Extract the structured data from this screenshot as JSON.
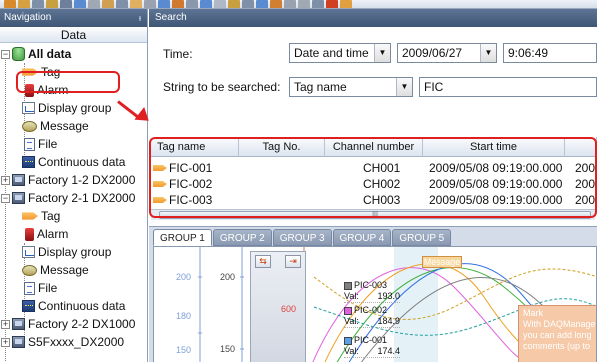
{
  "navigation": {
    "title": "Navigation",
    "pin_label": "ᵻ",
    "data_header": "Data",
    "tree": {
      "root_label": "All data",
      "root_children": [
        "Tag",
        "Alarm",
        "Display group",
        "Message",
        "File",
        "Continuous data"
      ],
      "groups": [
        {
          "label": "Factory 1-2 DX2000",
          "expander": "+"
        },
        {
          "label": "Factory 2-1 DX2000",
          "expander": "−",
          "children": [
            "Tag",
            "Alarm",
            "Display group",
            "Message",
            "File",
            "Continuous data"
          ]
        },
        {
          "label": "Factory 2-2 DX1000",
          "expander": "+"
        },
        {
          "label": "S5Fxxxx_DX2000",
          "expander": "+"
        }
      ]
    }
  },
  "search": {
    "title": "Search",
    "time_label": "Time:",
    "time_mode": "Date and time",
    "date_value": "2009/06/27",
    "time_value": "9:06:49",
    "string_label": "String to be searched:",
    "string_mode": "Tag name",
    "search_value": "FIC",
    "grid": {
      "columns": [
        "Tag name",
        "Tag No.",
        "Channel number",
        "Start time"
      ],
      "rows": [
        {
          "tag": "FIC-001",
          "tagno": "",
          "channel": "CH001",
          "start": "2009/05/08 09:19:00.000",
          "extra": "200"
        },
        {
          "tag": "FIC-002",
          "tagno": "",
          "channel": "CH002",
          "start": "2009/05/08 09:19:00.000",
          "extra": "200"
        },
        {
          "tag": "FIC-003",
          "tagno": "",
          "channel": "CH003",
          "start": "2009/05/08 09:19:00.000",
          "extra": "200"
        }
      ],
      "scroll_grip": "III"
    }
  },
  "chart_panel": {
    "tabs": [
      "GROUP 1",
      "GROUP 2",
      "GROUP 3",
      "GROUP 4",
      "GROUP 5"
    ],
    "active_tab": "GROUP 1",
    "axis_left": [
      "200",
      "180",
      "150"
    ],
    "axis_second": [
      "200",
      "150"
    ],
    "axis_red": "600",
    "message_label": "Message",
    "values": [
      {
        "tag": "PIC-003",
        "label": "Val:",
        "value": "193.0",
        "color": "#808080"
      },
      {
        "tag": "PIC-002",
        "label": "Val:",
        "value": "184.9",
        "color": "#e060e0"
      },
      {
        "tag": "PIC-001",
        "label": "Val:",
        "value": "174.4",
        "color": "#5aa0e8"
      }
    ],
    "mark_note": {
      "title": "Mark",
      "lines": [
        "With DAQManage",
        "you can add long",
        "comments (up to"
      ]
    }
  }
}
